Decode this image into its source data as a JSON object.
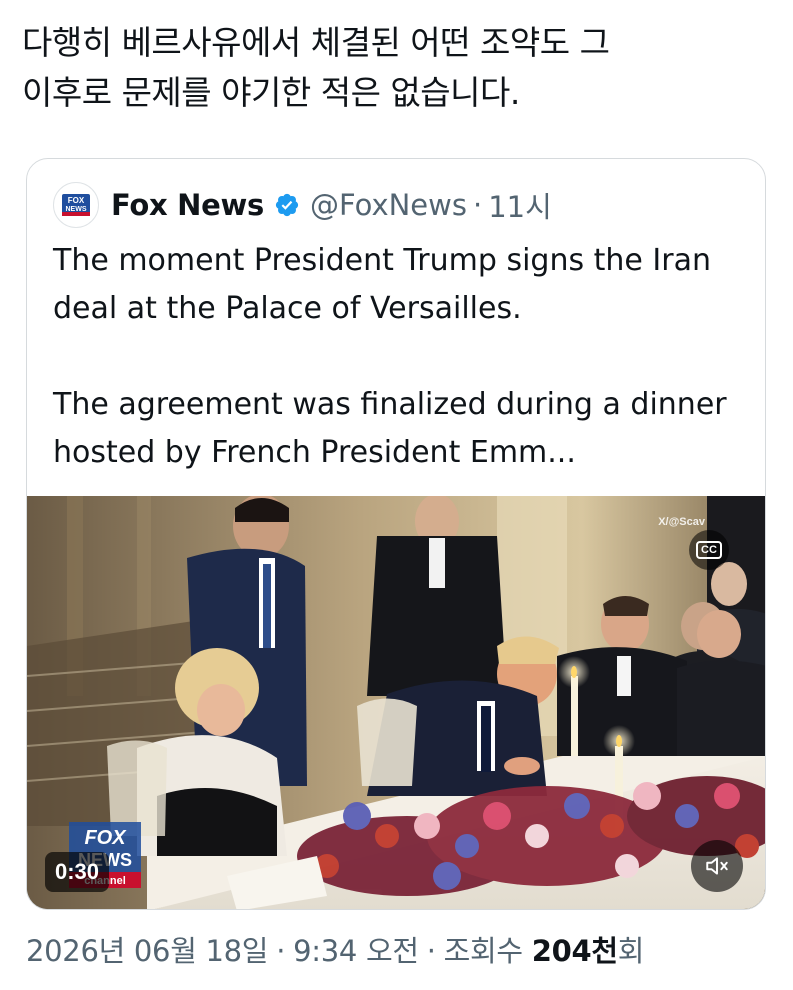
{
  "post": {
    "text_line1": "다행히 베르사유에서 체결된 어떤 조약도 그",
    "text_line2": "이후로 문제를 야기한 적은 없습니다."
  },
  "quote": {
    "avatar_text": "FOX NEWS",
    "author_name": "Fox News",
    "handle": "@FoxNews",
    "separator": "·",
    "time_ago": "11시",
    "paragraph1": "The moment President Trump signs the Iran deal at the Palace of Versailles.",
    "paragraph2": "The agreement was finalized during a dinner hosted by French President Emm...",
    "media": {
      "watermark": "X/@Scav",
      "cc_label": "CC",
      "duration": "0:30",
      "bug_text_top": "FOX",
      "bug_text_bottom": "NEWS",
      "bug_text_channel": "channel"
    }
  },
  "meta": {
    "date": "2026년 06월 18일",
    "separator": "·",
    "time": "9:34 오전",
    "views_label": "조회수",
    "views_count": "204천",
    "views_unit": "회"
  },
  "colors": {
    "text_primary": "#0f1419",
    "text_secondary": "#536471",
    "verified_blue": "#1d9bf0",
    "card_border": "#d6dadd",
    "fox_blue": "#1f4e9e",
    "fox_red": "#c8102e"
  },
  "icons": {
    "verified": "verified-badge-icon",
    "cc": "closed-captions-icon",
    "mute": "speaker-muted-icon"
  }
}
